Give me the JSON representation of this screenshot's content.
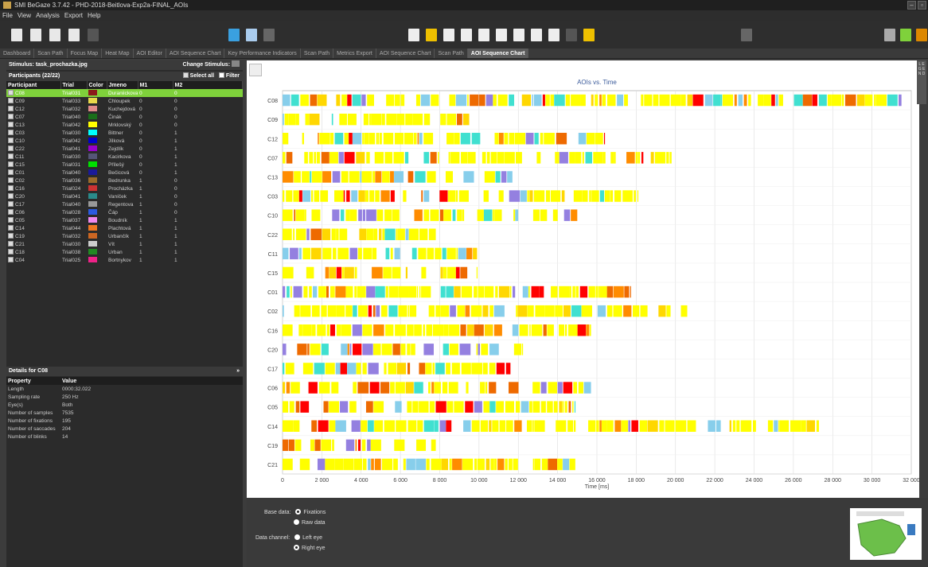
{
  "window": {
    "title": "SMI BeGaze 3.7.42 - PHD-2018-Beitlova-Exp2a-FINAL_AOIs"
  },
  "menu": [
    "File",
    "View",
    "Analysis",
    "Export",
    "Help"
  ],
  "tabs": [
    "Dashboard",
    "Scan Path",
    "Focus Map",
    "Heat Map",
    "AOI Editor",
    "AOI Sequence Chart",
    "Key Performance Indicators",
    "Scan Path",
    "Metrics Export",
    "AOI Sequence Chart",
    "Scan Path",
    "AOI Sequence Chart"
  ],
  "left": {
    "stimulus_label": "Stimulus: task_prochazka.jpg",
    "change_stimulus": "Change Stimulus:",
    "participants_title": "Participants (22/22)",
    "select_all": "Select all",
    "filter": "Filter",
    "columns": [
      "Participant",
      "Trial",
      "Color",
      "Jmeno",
      "M1",
      "M2"
    ],
    "rows": [
      {
        "p": "C08",
        "t": "Trial031",
        "c": "#8b1a1a",
        "n": "Duraniickova",
        "m1": "0",
        "m2": "0"
      },
      {
        "p": "C09",
        "t": "Trial033",
        "c": "#e8d84a",
        "n": "Chloupek",
        "m1": "0",
        "m2": "0"
      },
      {
        "p": "C12",
        "t": "Trial032",
        "c": "#e08a8a",
        "n": "Kuchejdová",
        "m1": "0",
        "m2": "0"
      },
      {
        "p": "C07",
        "t": "Trial040",
        "c": "#1a6e1a",
        "n": "Činák",
        "m1": "0",
        "m2": "0"
      },
      {
        "p": "C13",
        "t": "Trial042",
        "c": "#ffff00",
        "n": "Mrklovský",
        "m1": "0",
        "m2": "0"
      },
      {
        "p": "C03",
        "t": "Trial030",
        "c": "#00ffff",
        "n": "Bittner",
        "m1": "0",
        "m2": "1"
      },
      {
        "p": "C10",
        "t": "Trial042",
        "c": "#0000cc",
        "n": "Jílková",
        "m1": "0",
        "m2": "1"
      },
      {
        "p": "C22",
        "t": "Trial041",
        "c": "#9900cc",
        "n": "Zejdlík",
        "m1": "0",
        "m2": "1"
      },
      {
        "p": "C11",
        "t": "Trial030",
        "c": "#555577",
        "n": "Kacirkova",
        "m1": "0",
        "m2": "1"
      },
      {
        "p": "C15",
        "t": "Trial031",
        "c": "#00e000",
        "n": "Přílešý",
        "m1": "0",
        "m2": "1"
      },
      {
        "p": "C01",
        "t": "Trial040",
        "c": "#1a1a99",
        "n": "Bečicová",
        "m1": "0",
        "m2": "1"
      },
      {
        "p": "C02",
        "t": "Trial036",
        "c": "#9a6b2a",
        "n": "Bedrunka",
        "m1": "1",
        "m2": "0"
      },
      {
        "p": "C16",
        "t": "Trial024",
        "c": "#cc3333",
        "n": "Procházka",
        "m1": "1",
        "m2": "0"
      },
      {
        "p": "C20",
        "t": "Trial041",
        "c": "#2a8a8a",
        "n": "Vaníček",
        "m1": "1",
        "m2": "0"
      },
      {
        "p": "C17",
        "t": "Trial040",
        "c": "#999999",
        "n": "Regentova",
        "m1": "1",
        "m2": "0"
      },
      {
        "p": "C06",
        "t": "Trial028",
        "c": "#2a5ae0",
        "n": "Čáp",
        "m1": "1",
        "m2": "0"
      },
      {
        "p": "C05",
        "t": "Trial037",
        "c": "#ee88ee",
        "n": "Boudník",
        "m1": "1",
        "m2": "1"
      },
      {
        "p": "C14",
        "t": "Trial044",
        "c": "#ee7722",
        "n": "Plachtová",
        "m1": "1",
        "m2": "1"
      },
      {
        "p": "C19",
        "t": "Trial032",
        "c": "#cc6622",
        "n": "Urbančík",
        "m1": "1",
        "m2": "1"
      },
      {
        "p": "C21",
        "t": "Trial030",
        "c": "#cccccc",
        "n": "Vít",
        "m1": "1",
        "m2": "1"
      },
      {
        "p": "C18",
        "t": "Trial038",
        "c": "#228822",
        "n": "Urban",
        "m1": "1",
        "m2": "1"
      },
      {
        "p": "C04",
        "t": "Trial025",
        "c": "#ee2288",
        "n": "Bortnykov",
        "m1": "1",
        "m2": "1"
      }
    ],
    "details_title": "Details for C08",
    "details_columns": [
      "Property",
      "Value"
    ],
    "details": [
      [
        "Length",
        "0000:32.022"
      ],
      [
        "Sampling rate",
        "250 Hz"
      ],
      [
        "Eye(s)",
        "Both"
      ],
      [
        "Number of samples",
        "7535"
      ],
      [
        "Number of fixations",
        "195"
      ],
      [
        "Number of saccades",
        "204"
      ],
      [
        "Number of blinks",
        "14"
      ]
    ]
  },
  "bottom": {
    "base_data_label": "Base data:",
    "opt_fixations": "Fixations",
    "opt_raw": "Raw data",
    "data_channel_label": "Data channel:",
    "opt_left": "Left eye",
    "opt_right": "Right eye"
  },
  "legend_strip": "L E G E N D",
  "chart_data": {
    "type": "sequence",
    "title": "AOIs vs. Time",
    "xlabel": "Time [ms]",
    "xlim": [
      0,
      32000
    ],
    "xticks": [
      "0",
      "2 000",
      "4 000",
      "6 000",
      "8 000",
      "10 000",
      "12 000",
      "14 000",
      "16 000",
      "18 000",
      "20 000",
      "22 000",
      "24 000",
      "26 000",
      "28 000",
      "30 000",
      "32 000"
    ],
    "rows": [
      "C08",
      "C09",
      "C12",
      "C07",
      "C13",
      "C03",
      "C10",
      "C22",
      "C11",
      "C15",
      "C01",
      "C02",
      "C16",
      "C20",
      "C17",
      "C06",
      "C05",
      "C14",
      "C19",
      "C21"
    ],
    "row_end_ms": [
      31500,
      9500,
      16400,
      19800,
      11700,
      18100,
      15000,
      7800,
      9900,
      9900,
      17700,
      20600,
      15700,
      12200,
      11600,
      15700,
      14900,
      27300,
      7800,
      14900
    ],
    "aoi_colors": [
      "#ffff00",
      "#9480e0",
      "#ff8c00",
      "#ffd700",
      "#ff0000",
      "#87ceeb",
      "#40e0d0",
      "#ee6a00"
    ]
  }
}
